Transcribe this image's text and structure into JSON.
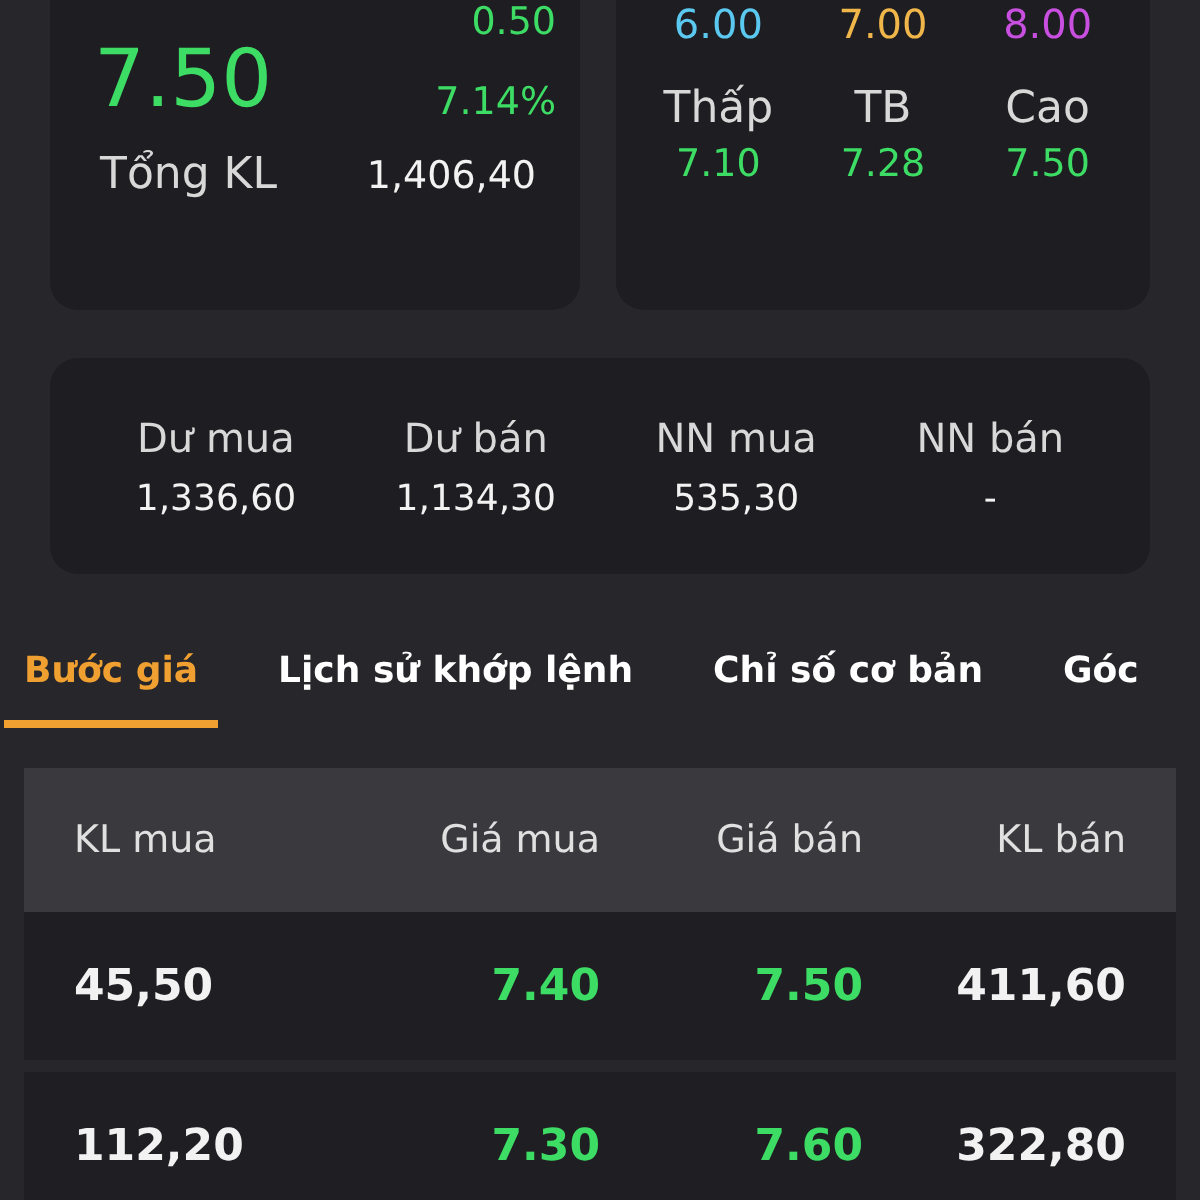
{
  "quote": {
    "price": "7.50",
    "change": "0.50",
    "change_percent": "7.14%",
    "total_volume_label": "Tổng KL",
    "total_volume": "1,406,40"
  },
  "reference_prices": [
    {
      "value": "6.00",
      "color": "#5bc8f0"
    },
    {
      "value": "7.00",
      "color": "#f0b64a"
    },
    {
      "value": "8.00",
      "color": "#c94fe0"
    }
  ],
  "price_range": [
    {
      "label": "Thấp",
      "value": "7.10"
    },
    {
      "label": "TB",
      "value": "7.28"
    },
    {
      "label": "Cao",
      "value": "7.50"
    }
  ],
  "order_summary": [
    {
      "label": "Dư mua",
      "value": "1,336,60"
    },
    {
      "label": "Dư bán",
      "value": "1,134,30"
    },
    {
      "label": "NN mua",
      "value": "535,30"
    },
    {
      "label": "NN bán",
      "value": "-"
    }
  ],
  "tabs": [
    {
      "label": "Bước giá",
      "selected": true
    },
    {
      "label": "Lịch sử khớp lệnh",
      "selected": false
    },
    {
      "label": "Chỉ số cơ bản",
      "selected": false
    },
    {
      "label": "Góc",
      "selected": false
    }
  ],
  "order_book": {
    "columns": [
      "KL mua",
      "Giá mua",
      "Giá bán",
      "KL bán"
    ],
    "rows": [
      {
        "buy_volume": "45,50",
        "bid": "7.40",
        "ask": "7.50",
        "sell_volume": "411,60"
      },
      {
        "buy_volume": "112,20",
        "bid": "7.30",
        "ask": "7.60",
        "sell_volume": "322,80"
      }
    ]
  }
}
